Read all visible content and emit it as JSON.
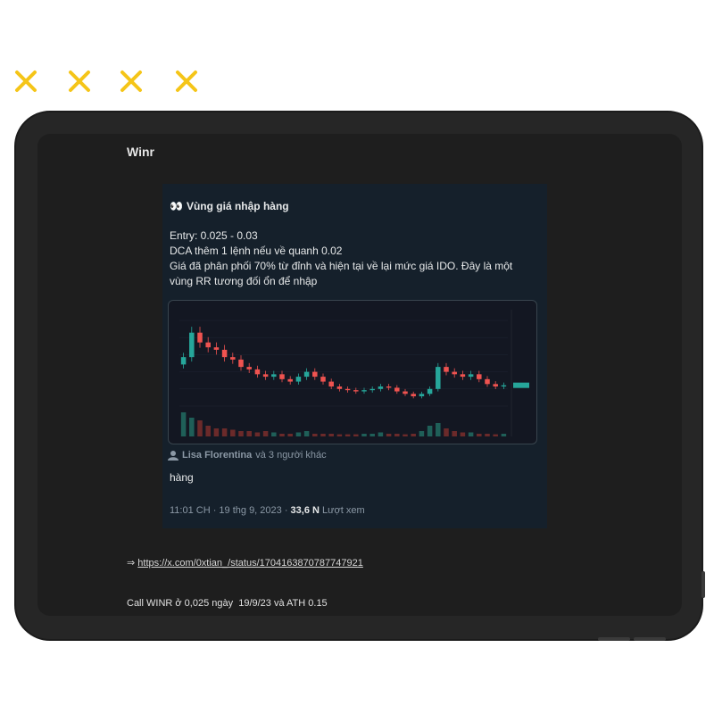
{
  "decor": {
    "mark_color": "#f5c518",
    "mark_count": 4
  },
  "app": {
    "title": "Winr"
  },
  "tweet": {
    "heading": "Vùng giá nhập hàng",
    "lines": [
      "Entry: 0.025 - 0.03",
      "DCA thêm 1 lệnh nếu về quanh 0.02",
      "Giá đã phân phối 70% từ đỉnh và hiện tại về lại mức giá IDO. Đây là một",
      "vùng RR tương đối ổn để nhập"
    ],
    "liker_name": "Lisa Florentina",
    "liker_suffix": "và 3 người khác",
    "reply": "hàng",
    "time": "11:01 CH · 19 thg 9, 2023 · ",
    "views": "33,6 N",
    "views_label": " Lượt xem"
  },
  "chart_data": {
    "type": "line",
    "title": "",
    "x": [
      0,
      1,
      2,
      3,
      4,
      5,
      6,
      7,
      8,
      9,
      10,
      11,
      12,
      13,
      14,
      15,
      16,
      17,
      18,
      19,
      20,
      21,
      22,
      23,
      24,
      25,
      26,
      27,
      28,
      29,
      30,
      31,
      32,
      33,
      34,
      35,
      36,
      37,
      38,
      39
    ],
    "series": [
      {
        "values": [
          0.06,
          0.08,
          0.072,
          0.068,
          0.066,
          0.06,
          0.058,
          0.052,
          0.05,
          0.046,
          0.044,
          0.046,
          0.042,
          0.04,
          0.044,
          0.048,
          0.044,
          0.04,
          0.036,
          0.034,
          0.033,
          0.032,
          0.033,
          0.034,
          0.036,
          0.035,
          0.032,
          0.03,
          0.028,
          0.03,
          0.034,
          0.052,
          0.048,
          0.046,
          0.044,
          0.046,
          0.042,
          0.038,
          0.036,
          0.037
        ]
      },
      {
        "values": [
          0.9,
          0.7,
          0.6,
          0.4,
          0.3,
          0.3,
          0.25,
          0.2,
          0.2,
          0.15,
          0.2,
          0.15,
          0.1,
          0.1,
          0.15,
          0.2,
          0.1,
          0.1,
          0.1,
          0.08,
          0.08,
          0.08,
          0.1,
          0.1,
          0.15,
          0.1,
          0.1,
          0.08,
          0.1,
          0.2,
          0.4,
          0.5,
          0.3,
          0.2,
          0.15,
          0.15,
          0.1,
          0.1,
          0.08,
          0.1
        ]
      }
    ],
    "ylim": [
      0.02,
      0.09
    ]
  },
  "footer": {
    "arrow": "⇒ ",
    "link": "https://x.com/0xtian_/status/1704163870787747921",
    "call": "Call WINR ở 0,025 ngày  19/9/23 và ATH 0.15"
  }
}
